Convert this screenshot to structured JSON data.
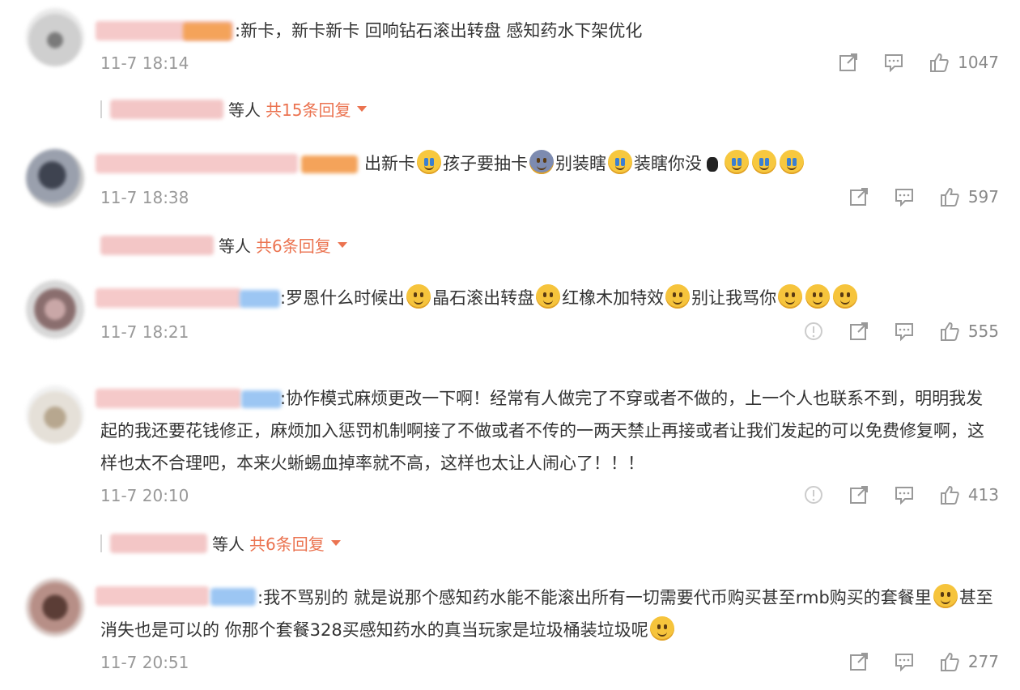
{
  "comments": [
    {
      "text_parts": [
        ":新卡，新卡新卡 回响钻石滚出转盘 感知药水下架优化"
      ],
      "time": "11-7 18:14",
      "likes": "1047",
      "has_report": false,
      "replies": {
        "who": "等人",
        "link": "共15条回复"
      }
    },
    {
      "text_parts": [
        "出新卡",
        "孩子要抽卡",
        "别装瞎",
        "装瞎你没",
        ""
      ],
      "time": "11-7 18:38",
      "likes": "597",
      "has_report": false,
      "replies": {
        "who": "等人",
        "link": "共6条回复"
      }
    },
    {
      "text_parts": [
        ":罗恩什么时候出",
        "晶石滚出转盘",
        "红橡木加特效",
        "别让我骂你"
      ],
      "time": "11-7 18:21",
      "likes": "555",
      "has_report": true
    },
    {
      "text_parts": [
        ":协作模式麻烦更改一下啊！经常有人做完了不穿或者不做的，上一个人也联系不到，明明我发起的我还要花钱修正，麻烦加入惩罚机制啊接了不做或者不传的一两天禁止再接或者让我们发起的可以免费修复啊，这样也太不合理吧，本来火蜥蜴血掉率就不高，这样也太让人闹心了！！！"
      ],
      "time": "11-7 20:10",
      "likes": "413",
      "has_report": true,
      "replies": {
        "who": "等人",
        "link": "共6条回复"
      }
    },
    {
      "text_parts": [
        ":我不骂别的 就是说那个感知药水能不能滚出所有一切需要代币购买甚至rmb购买的套餐里",
        "甚至消失也是可以的 你那个套餐328买感知药水的真当玩家是垃圾桶装垃圾呢"
      ],
      "time": "11-7 20:51",
      "likes": "277",
      "has_report": false
    }
  ],
  "icons": {
    "share": "share-icon",
    "comment": "comment-icon",
    "like": "thumbs-up-icon",
    "report": "report-icon",
    "caret": "caret-down-icon"
  },
  "colors": {
    "link": "#eb7350",
    "meta": "#999999",
    "text": "#333333"
  }
}
